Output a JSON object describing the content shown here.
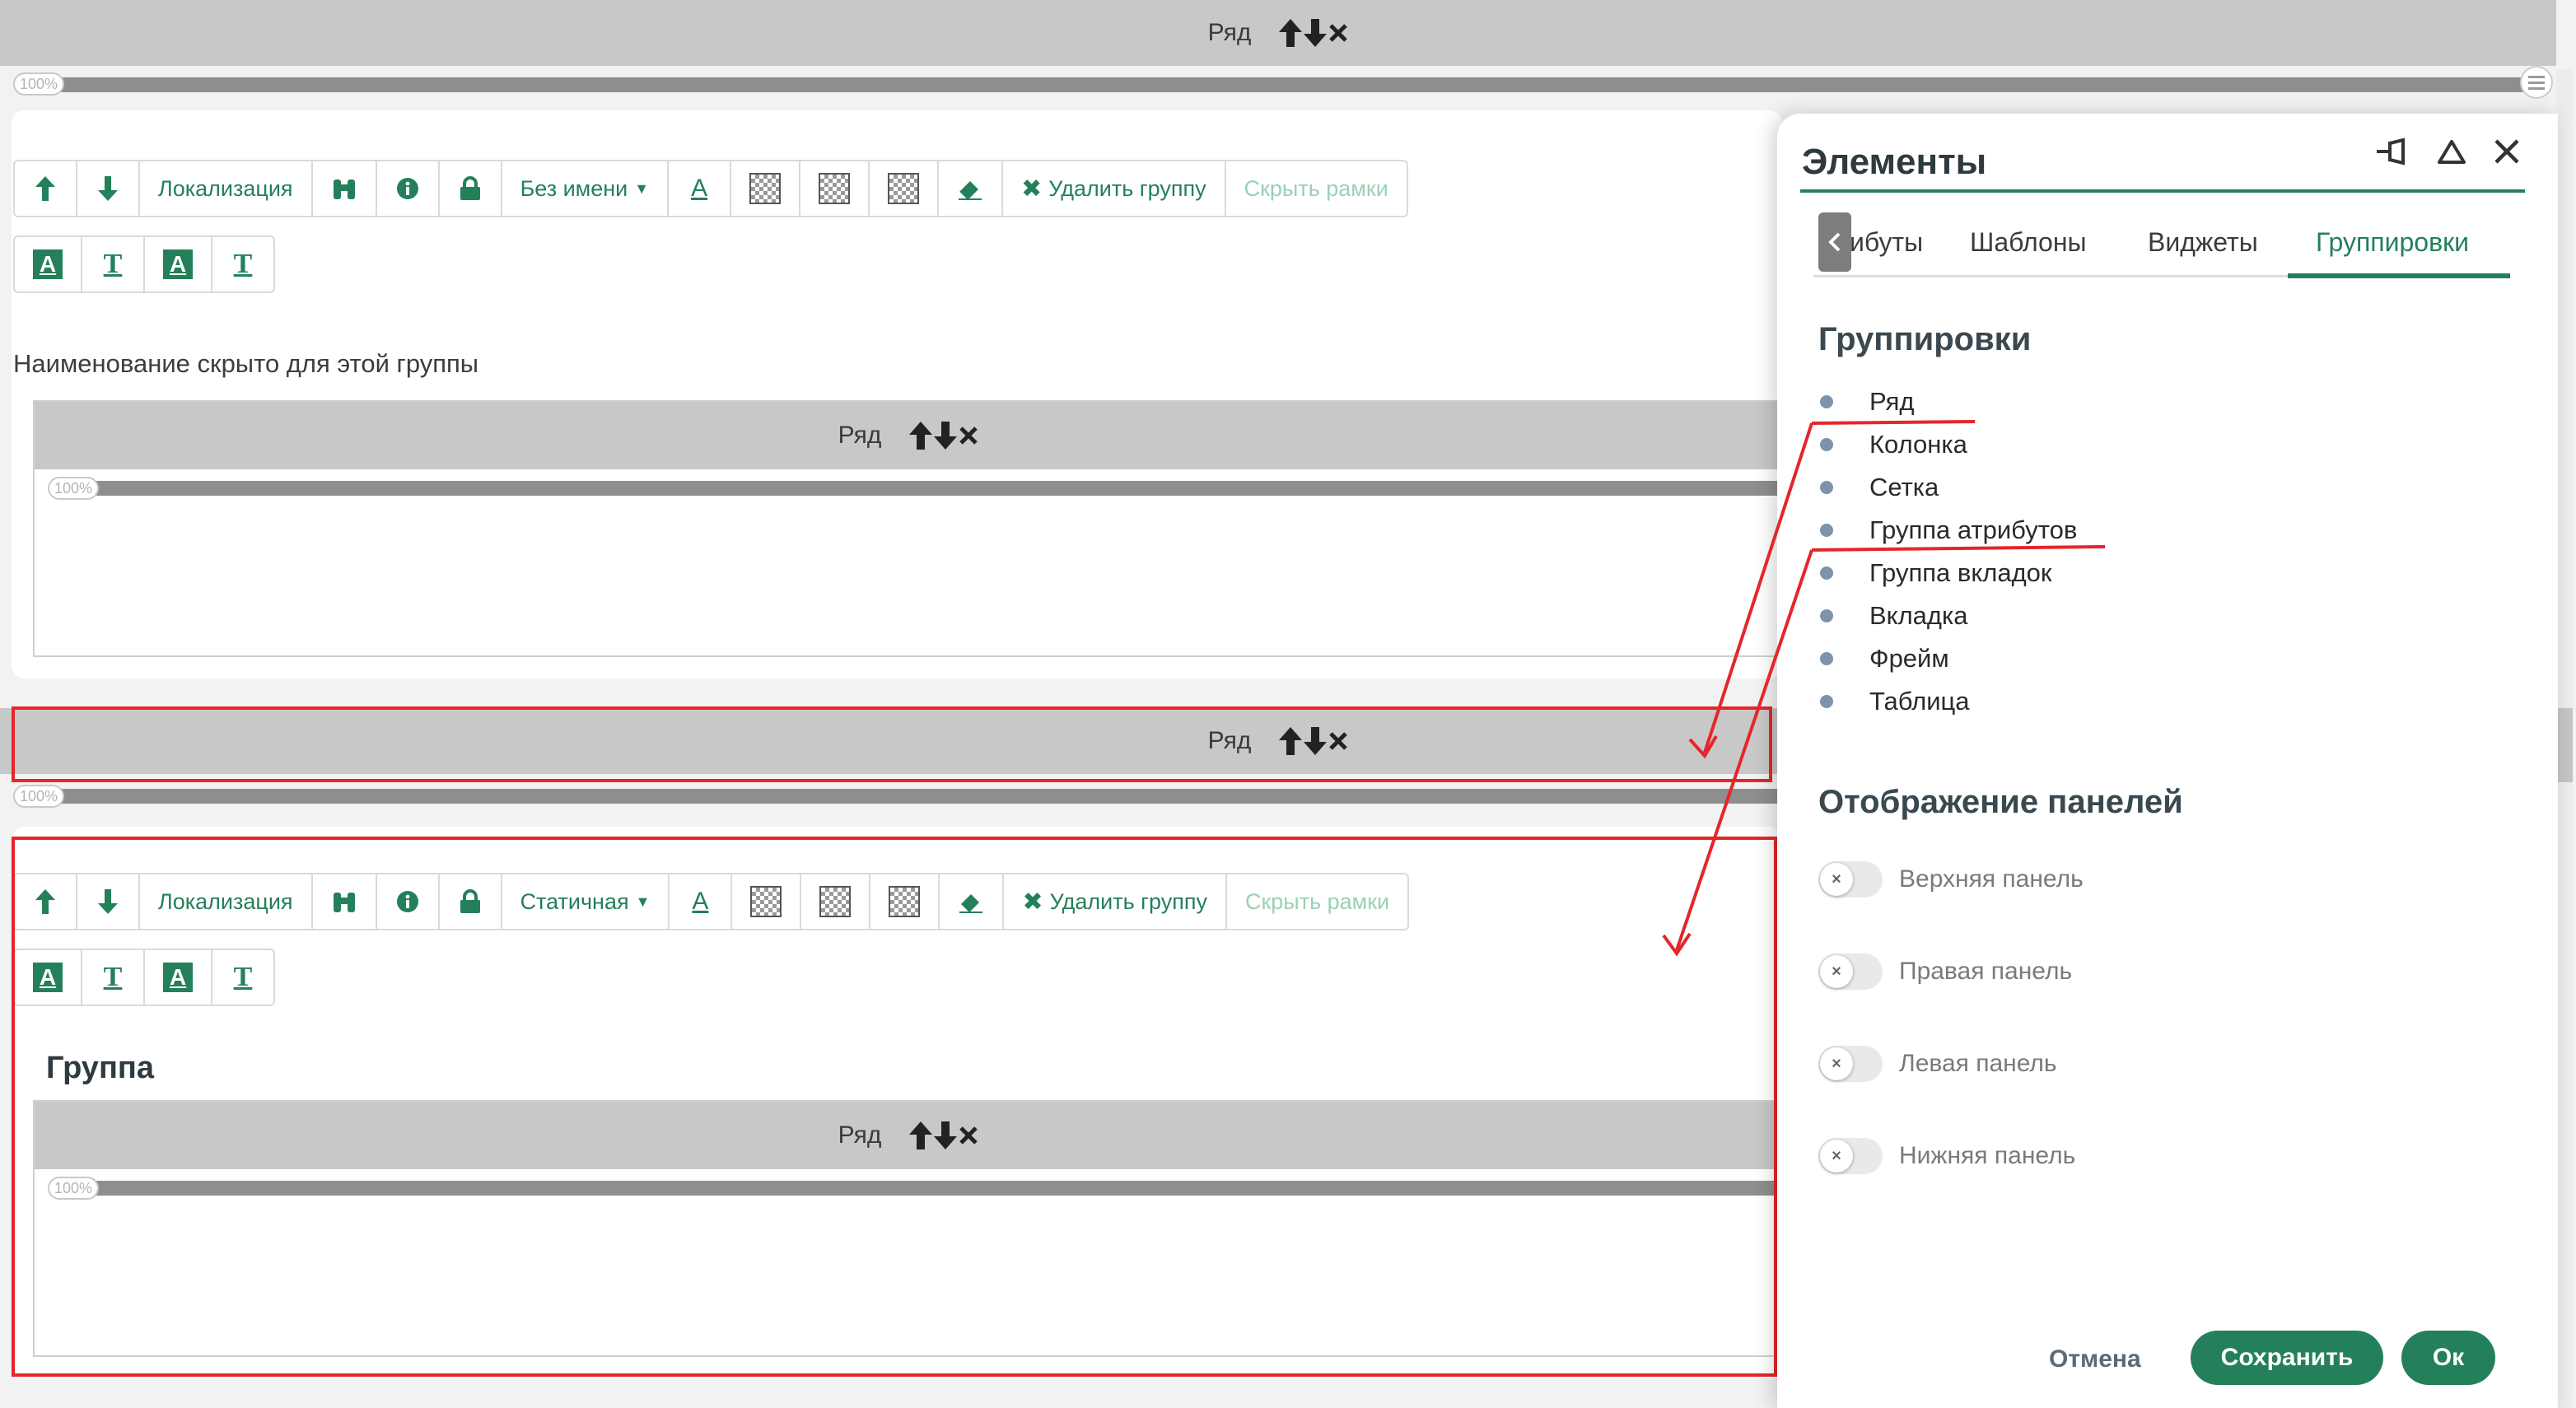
{
  "row_label": "Ряд",
  "slider_label": "100%",
  "toolbar": {
    "localization": "Локализация",
    "name_mode_top": "Без имени",
    "name_mode_bottom": "Статичная",
    "delete_group": "Удалить группу",
    "hide_frames": "Скрыть рамки"
  },
  "hidden_name_text": "Наименование скрыто для этой группы",
  "group_title": "Группа",
  "panel": {
    "title": "Элементы",
    "tabs": [
      "ибуты",
      "Шаблоны",
      "Виджеты",
      "Группировки"
    ],
    "active_tab": "Группировки",
    "groupings_heading": "Группировки",
    "groupings": [
      "Ряд",
      "Колонка",
      "Сетка",
      "Группа атрибутов",
      "Группа вкладок",
      "Вкладка",
      "Фрейм",
      "Таблица"
    ],
    "display_heading": "Отображение панелей",
    "toggles": [
      "Верхняя панель",
      "Правая панель",
      "Левая панель",
      "Нижняя панель"
    ],
    "cancel": "Отмена",
    "save": "Сохранить",
    "ok": "Ок"
  },
  "colors": {
    "accent": "#24805a",
    "annotation": "#e5262b",
    "row_bar": "#c8c8c8"
  },
  "icons": [
    "arrow-up-icon",
    "arrow-down-icon",
    "binoculars-icon",
    "info-icon",
    "lock-icon",
    "caret-down-icon",
    "text-color-icon",
    "checkerboard-icon",
    "eraser-icon",
    "delete-x-icon",
    "pin-icon",
    "collapse-icon",
    "close-icon",
    "chevron-left-icon",
    "menu-icon"
  ]
}
